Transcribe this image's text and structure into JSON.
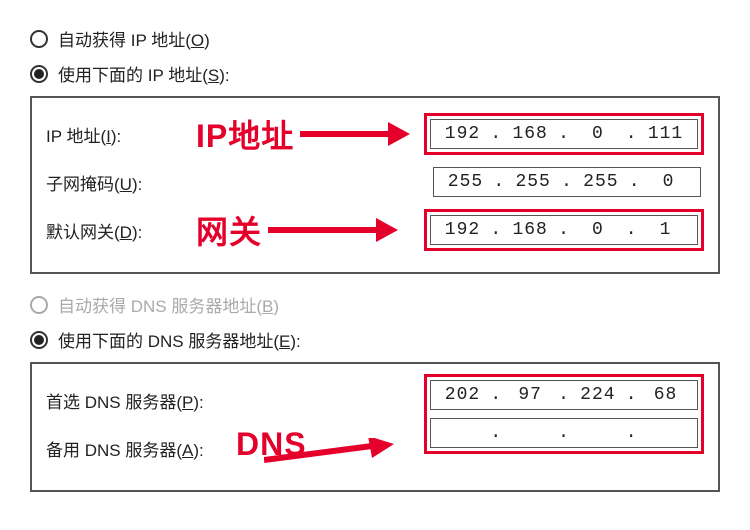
{
  "ip_section": {
    "auto_label_pre": "自动获得 IP 地址(",
    "auto_label_u": "O",
    "auto_label_post": ")",
    "manual_label_pre": "使用下面的 IP 地址(",
    "manual_label_u": "S",
    "manual_label_post": "):",
    "ip_label_pre": "IP 地址(",
    "ip_label_u": "I",
    "ip_label_post": "):",
    "mask_label_pre": "子网掩码(",
    "mask_label_u": "U",
    "mask_label_post": "):",
    "gw_label_pre": "默认网关(",
    "gw_label_u": "D",
    "gw_label_post": "):",
    "ip": {
      "o1": "192",
      "o2": "168",
      "o3": "0",
      "o4": "111"
    },
    "mask": {
      "o1": "255",
      "o2": "255",
      "o3": "255",
      "o4": "0"
    },
    "gateway": {
      "o1": "192",
      "o2": "168",
      "o3": "0",
      "o4": "1"
    }
  },
  "dns_section": {
    "auto_label_pre": "自动获得 DNS 服务器地址(",
    "auto_label_u": "B",
    "auto_label_post": ")",
    "manual_label_pre": "使用下面的 DNS 服务器地址(",
    "manual_label_u": "E",
    "manual_label_post": "):",
    "pref_label_pre": "首选 DNS 服务器(",
    "pref_label_u": "P",
    "pref_label_post": "):",
    "alt_label_pre": "备用 DNS 服务器(",
    "alt_label_u": "A",
    "alt_label_post": "):",
    "preferred": {
      "o1": "202",
      "o2": "97",
      "o3": "224",
      "o4": "68"
    },
    "alternate": {
      "o1": "",
      "o2": "",
      "o3": "",
      "o4": ""
    }
  },
  "annotations": {
    "ip": "IP地址",
    "gateway": "网关",
    "dns": "DNS"
  }
}
